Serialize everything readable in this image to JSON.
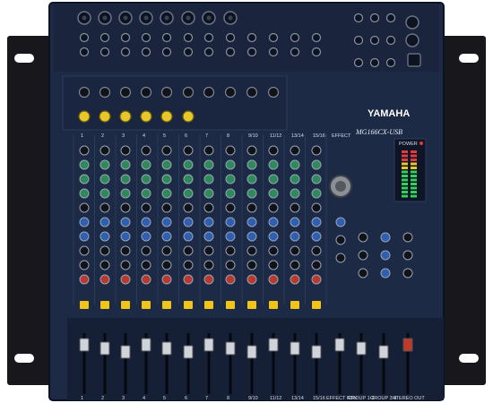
{
  "brand": "YAMAHA",
  "model": "MG166CX-USB",
  "mono_channels": [
    "1",
    "2",
    "3",
    "4",
    "5",
    "6",
    "7",
    "8"
  ],
  "stereo_channels": [
    "9/10",
    "11/12",
    "13/14",
    "15/16"
  ],
  "effect_label": "EFFECT",
  "bottom_labels": {
    "effect_rtn": "EFFECT RTN",
    "group_12": "GROUP 1-2",
    "group_34": "GROUP 3-4",
    "stereo_out": "STEREO OUT"
  },
  "power_label": "POWER",
  "colors": {
    "panel": "#1d2a45",
    "panel_edge": "#0b1222",
    "rack_ear": "#15151a",
    "knob_dark": "#101418",
    "knob_green": "#2e8a5a",
    "knob_blue": "#2f5fb0",
    "knob_red": "#b83a2e",
    "knob_yellow": "#e7c62a",
    "button_yellow": "#f0c419",
    "meter_green": "#34d058",
    "meter_red": "#e23b3b",
    "label_text": "#d9dee8"
  }
}
